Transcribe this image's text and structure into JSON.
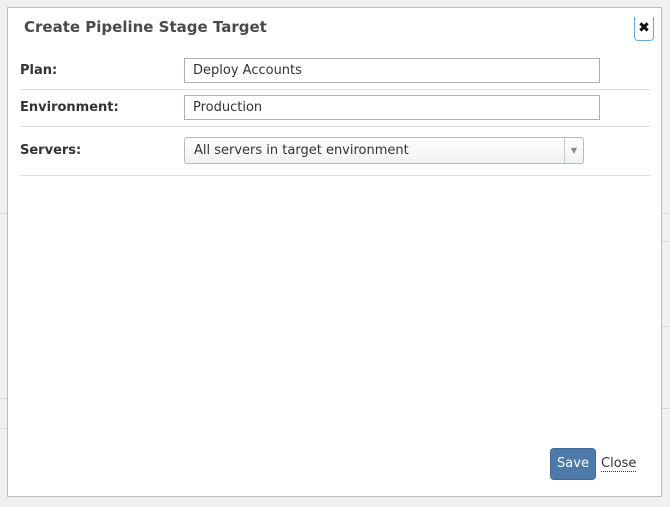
{
  "dialog": {
    "title": "Create Pipeline Stage Target",
    "close_glyph": "✖",
    "close_icon": "close-icon"
  },
  "form": {
    "plan": {
      "label": "Plan:",
      "value": "Deploy Accounts"
    },
    "environment": {
      "label": "Environment:",
      "value": "Production"
    },
    "servers": {
      "label": "Servers:",
      "selected": "All servers in target environment",
      "arrow_glyph": "▼"
    }
  },
  "footer": {
    "save_label": "Save",
    "close_label": "Close"
  },
  "colors": {
    "primary_button": "#4d7aa8",
    "title_text": "#4a4a4a",
    "focus_ring": "#6aa7d8"
  }
}
